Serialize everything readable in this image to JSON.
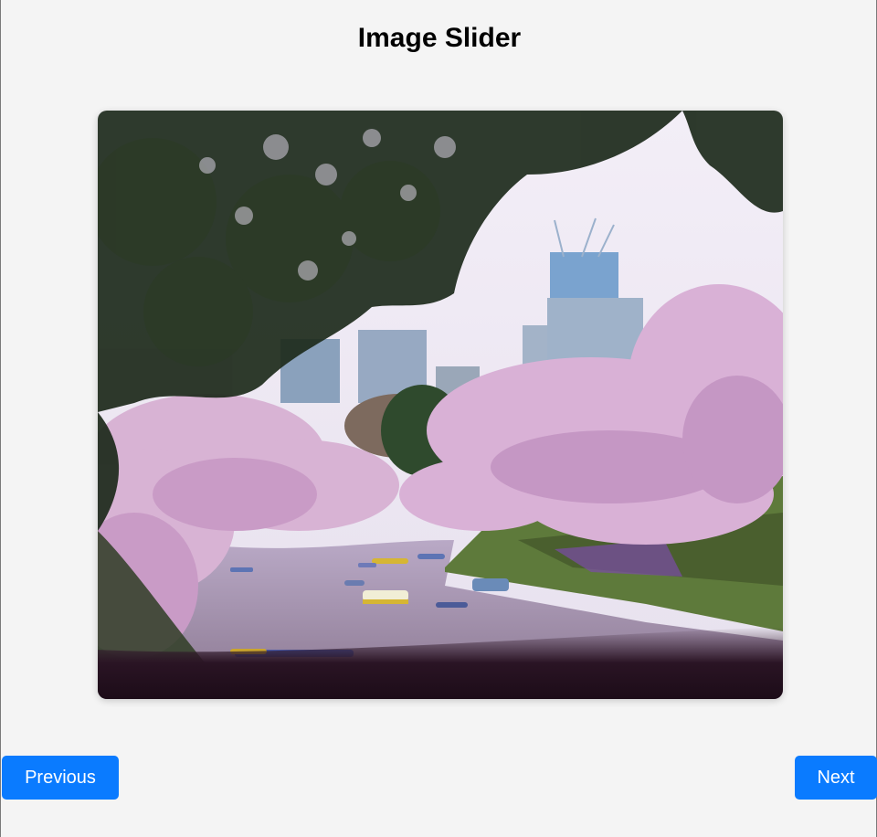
{
  "page": {
    "title": "Image Slider"
  },
  "controls": {
    "previous_label": "Previous",
    "next_label": "Next"
  },
  "colors": {
    "button_bg": "#0a7bff",
    "button_text": "#ffffff",
    "page_bg": "#f4f4f4"
  }
}
